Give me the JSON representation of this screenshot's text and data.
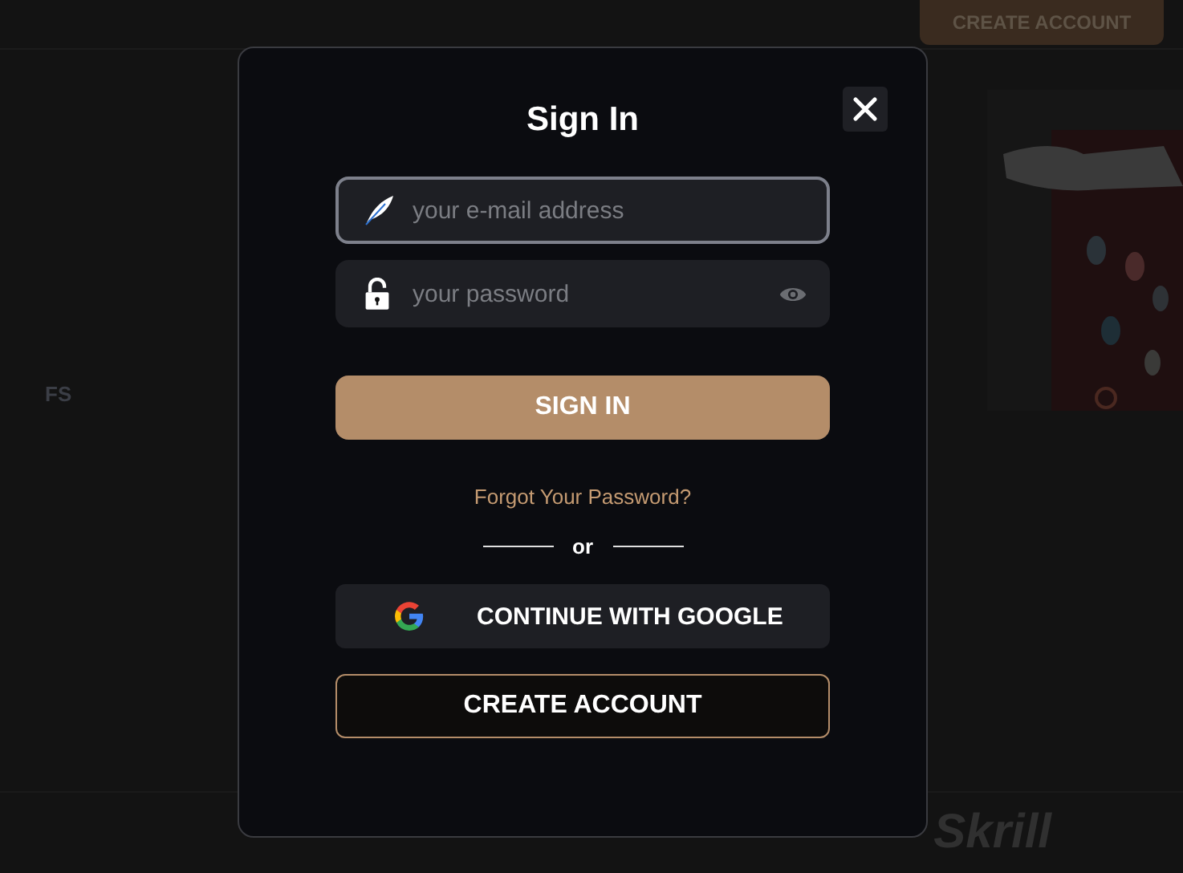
{
  "backdrop": {
    "header_button": "CREATE ACCOUNT",
    "tile_label": "FS",
    "payment_logo": "Skrill"
  },
  "dialog": {
    "title": "Sign In",
    "fields": [
      {
        "kind": "email",
        "placeholder": "your e-mail address",
        "focused": true
      },
      {
        "kind": "password",
        "placeholder": "your password",
        "focused": false
      }
    ],
    "submit": "SIGN IN",
    "forgot": "Forgot Your Password?",
    "separator": "or",
    "google": "CONTINUE WITH GOOGLE",
    "create": "CREATE ACCOUNT"
  }
}
